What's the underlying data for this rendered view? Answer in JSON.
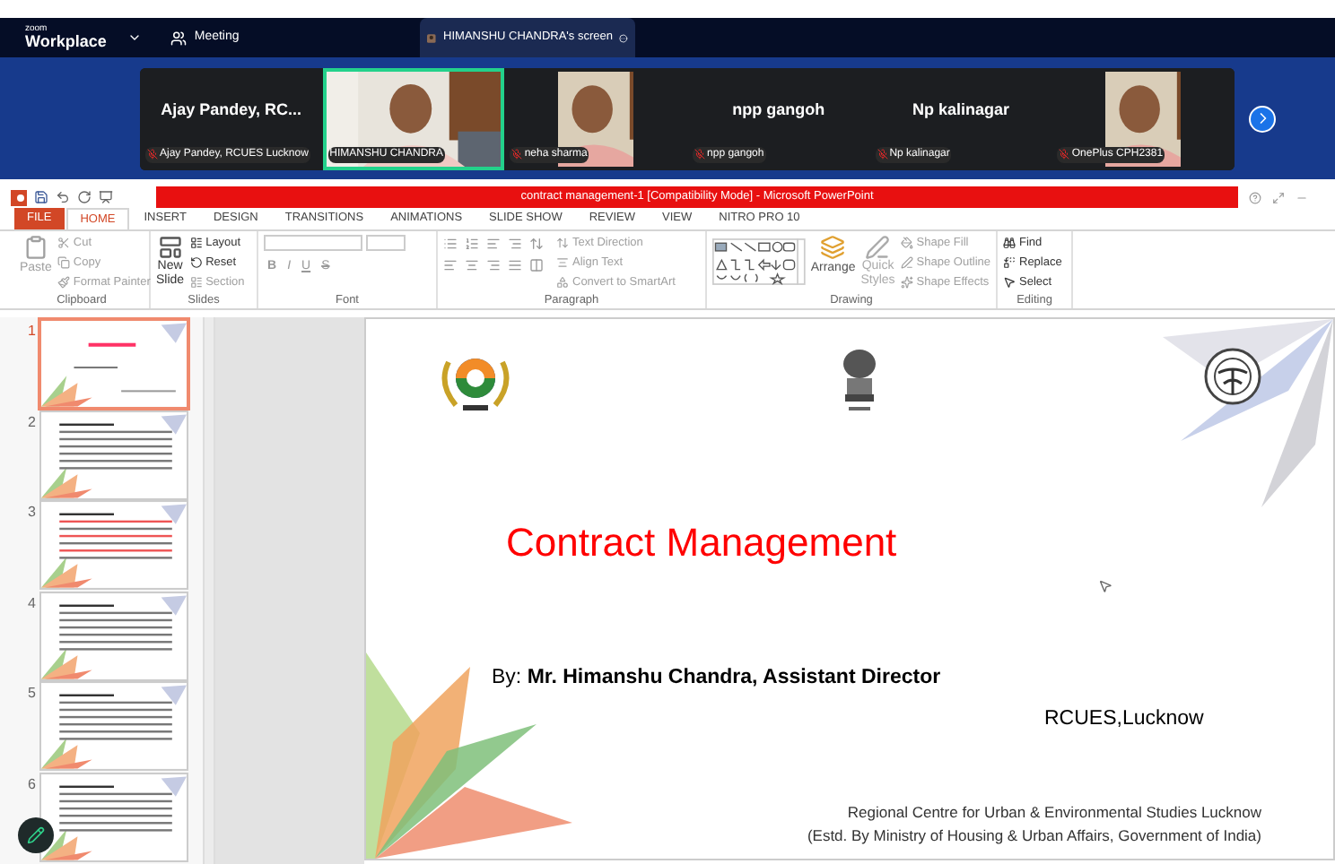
{
  "zoom": {
    "brand_small": "zoom",
    "brand": "Workplace",
    "meeting_label": "Meeting",
    "share_tab": "HIMANSHU CHANDRA's screen"
  },
  "participants": [
    {
      "display_name": "Ajay Pandey, RC...",
      "label": "Ajay Pandey, RCUES Lucknow",
      "muted": true,
      "speaking": false,
      "kind": "nocamera"
    },
    {
      "label": "HIMANSHU CHANDRA",
      "muted": false,
      "speaking": true,
      "kind": "camera"
    },
    {
      "label": "neha sharma",
      "muted": true,
      "speaking": false,
      "kind": "portrait"
    },
    {
      "display_name": "npp gangoh",
      "label": "npp gangoh",
      "muted": true,
      "speaking": false,
      "kind": "nocamera"
    },
    {
      "display_name": "Np kalinagar",
      "label": "Np kalinagar",
      "muted": true,
      "speaking": false,
      "kind": "nocamera"
    },
    {
      "label": "OnePlus CPH2381",
      "muted": true,
      "speaking": false,
      "kind": "portrait"
    }
  ],
  "powerpoint": {
    "title": "contract management-1 [Compatibility Mode] -  Microsoft PowerPoint",
    "tabs": [
      {
        "label": "FILE",
        "kind": "file",
        "selected": false
      },
      {
        "label": "HOME",
        "kind": "tab",
        "selected": true
      },
      {
        "label": "INSERT",
        "kind": "tab",
        "selected": false
      },
      {
        "label": "DESIGN",
        "kind": "tab",
        "selected": false
      },
      {
        "label": "TRANSITIONS",
        "kind": "tab",
        "selected": false
      },
      {
        "label": "ANIMATIONS",
        "kind": "tab",
        "selected": false
      },
      {
        "label": "SLIDE SHOW",
        "kind": "tab",
        "selected": false
      },
      {
        "label": "REVIEW",
        "kind": "tab",
        "selected": false
      },
      {
        "label": "VIEW",
        "kind": "tab",
        "selected": false
      },
      {
        "label": "NITRO PRO 10",
        "kind": "tab",
        "selected": false
      }
    ],
    "clipboard": {
      "group": "Clipboard",
      "paste": {
        "label": "Paste",
        "disabled": true
      },
      "commands": [
        {
          "label": "Cut",
          "disabled": true
        },
        {
          "label": "Copy",
          "disabled": true
        },
        {
          "label": "Format Painter",
          "disabled": true
        }
      ]
    },
    "slides": {
      "group": "Slides",
      "new_slide": [
        "New",
        "Slide"
      ],
      "commands": [
        {
          "label": "Layout",
          "disabled": false
        },
        {
          "label": "Reset",
          "disabled": false
        },
        {
          "label": "Section",
          "disabled": true
        }
      ]
    },
    "font": {
      "group": "Font",
      "buttons": [
        "B",
        "I",
        "U",
        "S"
      ]
    },
    "paragraph": {
      "group": "Paragraph",
      "commands": [
        {
          "label": "Text Direction",
          "disabled": true
        },
        {
          "label": "Align Text",
          "disabled": true
        },
        {
          "label": "Convert to SmartArt",
          "disabled": true
        }
      ]
    },
    "drawing": {
      "group": "Drawing",
      "arrange": "Arrange",
      "quick_styles": [
        "Quick",
        "Styles"
      ],
      "commands": [
        {
          "label": "Shape Fill",
          "disabled": true
        },
        {
          "label": "Shape Outline",
          "disabled": true
        },
        {
          "label": "Shape Effects",
          "disabled": true
        }
      ]
    },
    "editing": {
      "group": "Editing",
      "commands": [
        {
          "label": "Find",
          "disabled": false
        },
        {
          "label": "Replace",
          "disabled": false
        },
        {
          "label": "Select",
          "disabled": false
        }
      ]
    },
    "thumbnails": [
      {
        "number": "1",
        "selected": true
      },
      {
        "number": "2",
        "selected": false
      },
      {
        "number": "3",
        "selected": false
      },
      {
        "number": "4",
        "selected": false
      },
      {
        "number": "5",
        "selected": false
      },
      {
        "number": "6",
        "selected": false
      }
    ],
    "slide": {
      "title": "Contract Management",
      "byline": "By: **Mr. Himanshu Chandra, Assistant Director**",
      "place": "RCUES,Lucknow",
      "footer": [
        "Regional Centre for Urban & Environmental Studies Lucknow",
        "(Estd. By Ministry of Housing & Urban Affairs, Government of India)"
      ]
    }
  }
}
